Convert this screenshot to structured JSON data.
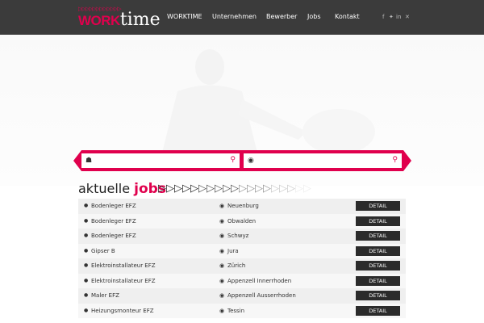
{
  "logo": {
    "work": "WORK",
    "time": "time",
    "arrows": "▷▷▷▷▷▷▷▷▷▷▷▷"
  },
  "nav": {
    "items": [
      "WORKTIME",
      "Unternehmen",
      "Bewerber",
      "Jobs",
      "Kontakt"
    ]
  },
  "social": {
    "icons": [
      "facebook-icon",
      "twitter-icon",
      "linkedin-icon",
      "xing-icon"
    ]
  },
  "search": {
    "job_value": "",
    "location_value": ""
  },
  "jobs_section": {
    "title_a": "aktuelle",
    "title_b": "jobs"
  },
  "jobs": [
    {
      "title": "Bodenleger EFZ",
      "location": "Neuenburg",
      "button": "DETAIL"
    },
    {
      "title": "Bodenleger EFZ",
      "location": "Obwalden",
      "button": "DETAIL"
    },
    {
      "title": "Bodenleger EFZ",
      "location": "Schwyz",
      "button": "DETAIL"
    },
    {
      "title": "Gipser B",
      "location": "Jura",
      "button": "DETAIL"
    },
    {
      "title": "Elektroinstallateur EFZ",
      "location": "Zürich",
      "button": "DETAIL"
    },
    {
      "title": "Elektroinstallateur EFZ",
      "location": "Appenzell Innerrhoden",
      "button": "DETAIL"
    },
    {
      "title": "Maler EFZ",
      "location": "Appenzell Ausserrhoden",
      "button": "DETAIL"
    },
    {
      "title": "Heizungsmonteur EFZ",
      "location": "Tessin",
      "button": "DETAIL"
    }
  ],
  "colors": {
    "accent": "#e0004d",
    "header": "#3b3b3b",
    "button": "#2b2b2b"
  }
}
